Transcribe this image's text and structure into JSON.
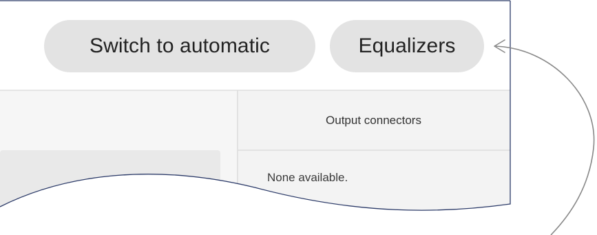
{
  "toolbar": {
    "switch_label": "Switch to automatic",
    "equalizers_label": "Equalizers"
  },
  "panel": {
    "column_header": "Output connectors",
    "empty_text": "None available."
  },
  "colors": {
    "pill_background": "#e3e3e3",
    "frame_border": "#2b3a68",
    "panel_background": "#f3f3f3",
    "inner_box": "#e9e9e9",
    "divider": "#dedede",
    "callout_arrow": "#888888"
  },
  "icons": [
    "callout-arrow-icon"
  ]
}
